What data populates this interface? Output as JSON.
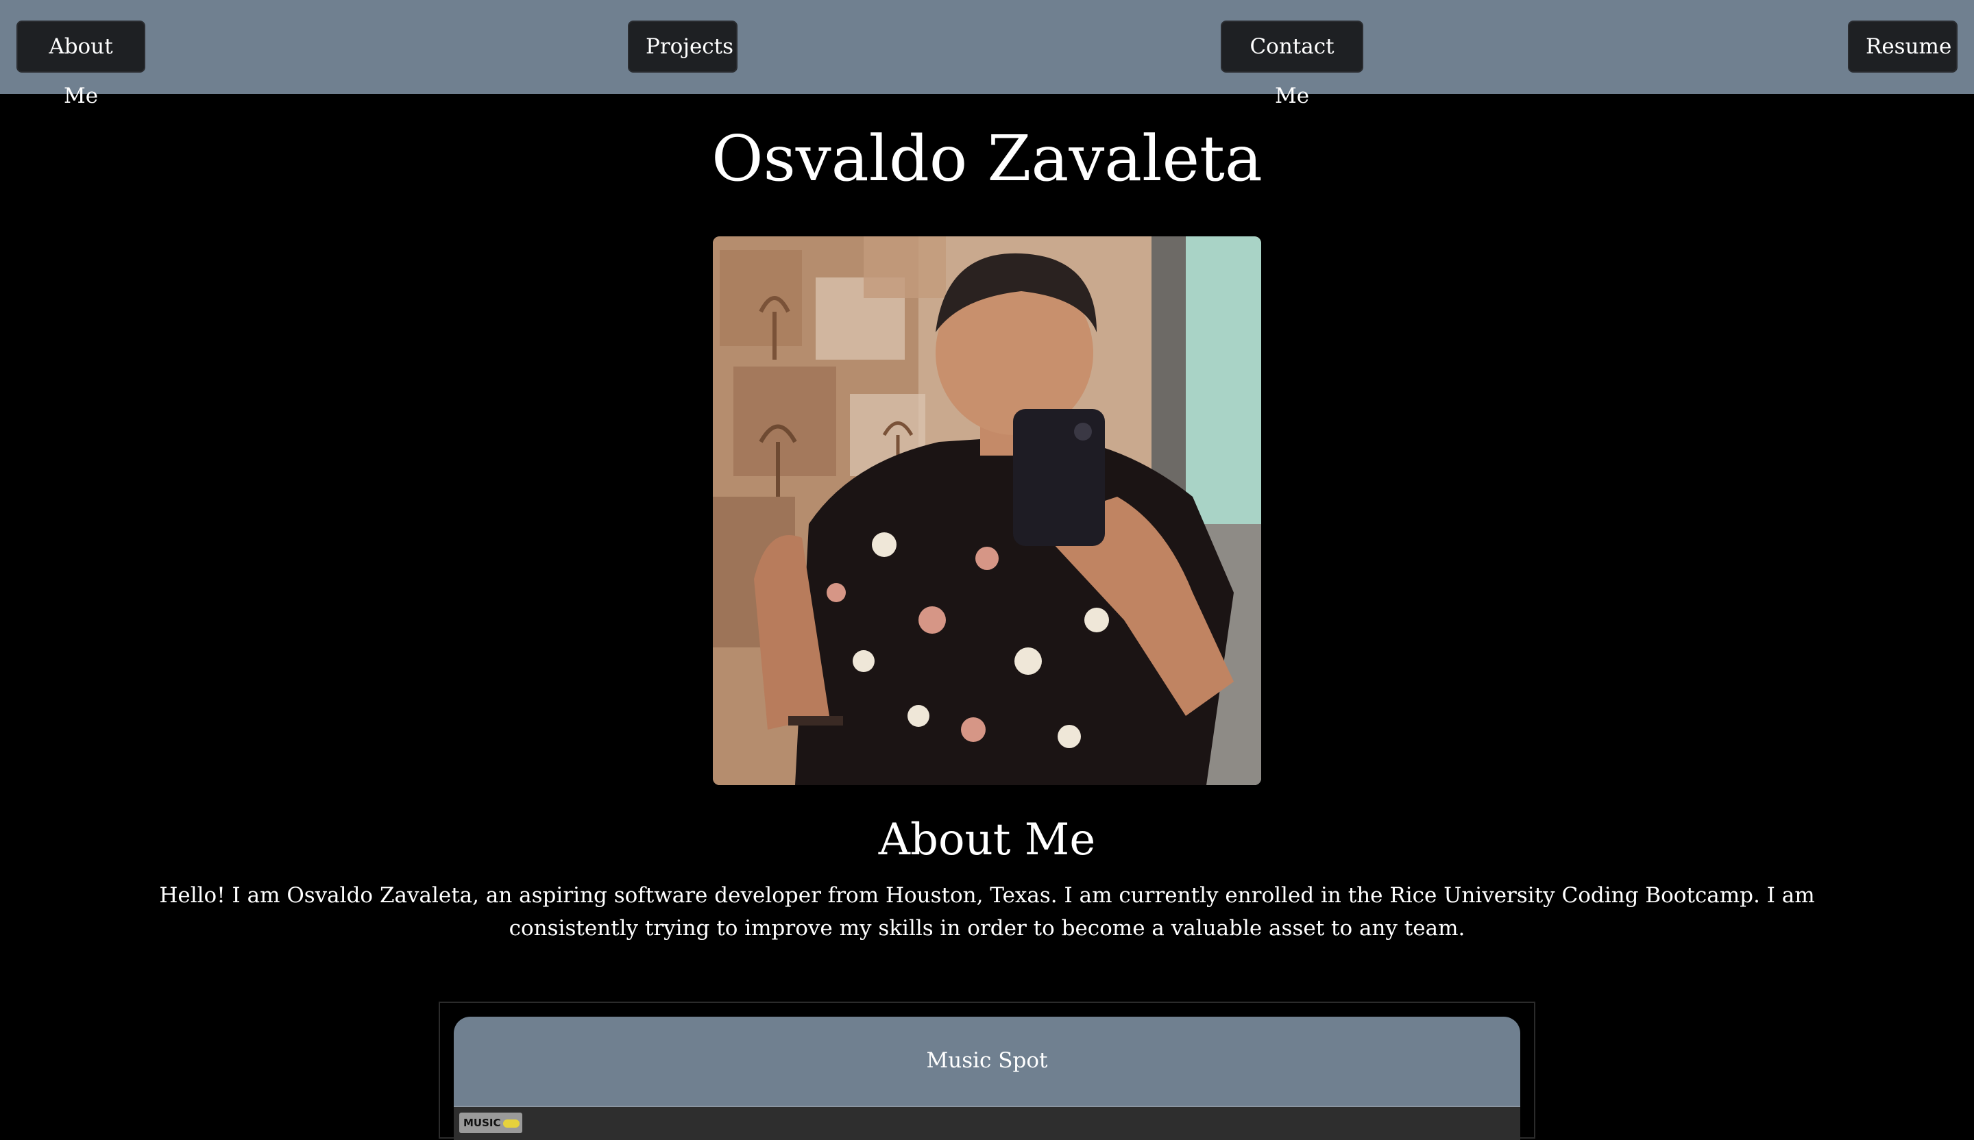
{
  "nav": {
    "about": "About Me",
    "projects": "Projects",
    "contact": "Contact Me",
    "resume": "Resume"
  },
  "header": {
    "name": "Osvaldo Zavaleta"
  },
  "about": {
    "heading": "About Me",
    "text": "Hello! I am Osvaldo Zavaleta, an aspiring software developer from Houston, Texas. I am currently enrolled in the Rice University Coding Bootcamp. I am consistently trying to improve my skills in order to become a valuable asset to any team."
  },
  "projects": {
    "items": [
      {
        "title": "Music Spot",
        "preview_logo": "MUSIC"
      }
    ]
  },
  "colors": {
    "navbar_bg": "#708090",
    "button_bg": "#1e2023",
    "page_bg": "#000000",
    "text": "#ffffff",
    "card_bg": "#708090"
  }
}
